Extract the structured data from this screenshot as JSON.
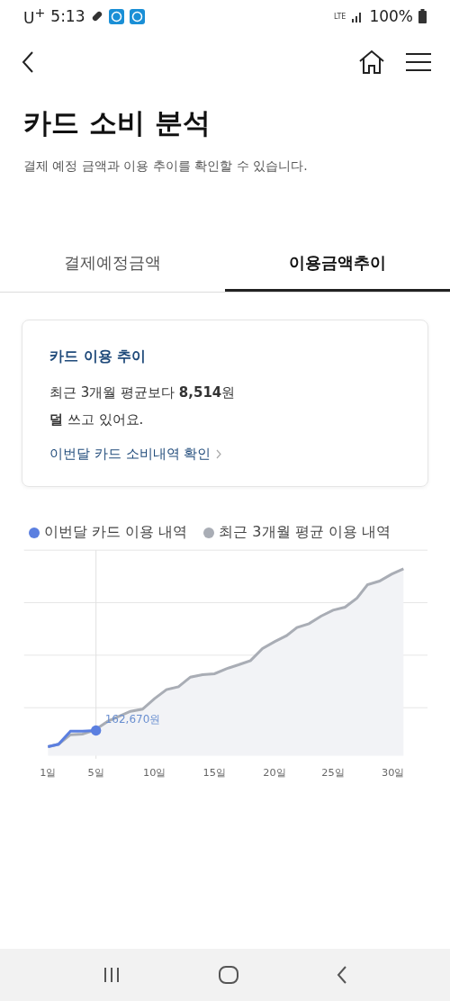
{
  "status_bar": {
    "carrier": "U$^{+}$",
    "time": "5:13",
    "network": "LTE",
    "battery": "100%"
  },
  "header": {
    "title": "카드 소비 분석",
    "subtitle": "결제 예정 금액과 이용 추이를 확인할 수 있습니다."
  },
  "tabs": [
    {
      "label": "결제예정금액",
      "selected": false
    },
    {
      "label": "이용금액추이",
      "selected": true
    }
  ],
  "card": {
    "title": "카드 이용 추이",
    "message": "최근 3개월 평균보다 **8,514**원\n**덜** 쓰고 있어요.",
    "link": "이번달 카드 소비내역 확인"
  },
  "chart": {
    "legend": [
      {
        "label": "이번달 카드 이용 내역",
        "color": "#5b7fe0"
      },
      {
        "label": "최근 3개월 평균 이용 내역",
        "color": "#a9adb5"
      }
    ],
    "value_label": "162,670원",
    "x_labels": [
      "1일",
      "5일",
      "10일",
      "15일",
      "20일",
      "25일",
      "30일"
    ]
  }
}
